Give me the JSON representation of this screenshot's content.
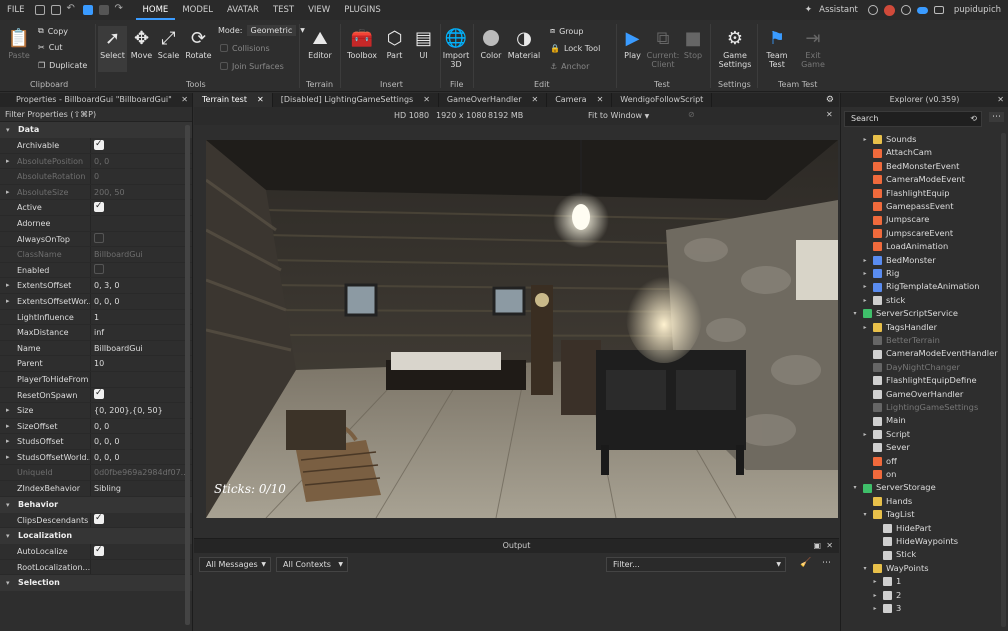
{
  "menu": {
    "items": [
      "FILE",
      "HOME",
      "MODEL",
      "AVATAR",
      "TEST",
      "VIEW",
      "PLUGINS"
    ],
    "assistant": "Assistant",
    "username": "pupidupich"
  },
  "ribbon": {
    "clipboard": {
      "paste": "Paste",
      "copy": "Copy",
      "cut": "Cut",
      "duplicate": "Duplicate",
      "label": "Clipboard"
    },
    "tools": {
      "select": "Select",
      "move": "Move",
      "scale": "Scale",
      "rotate": "Rotate",
      "mode_label": "Mode:",
      "mode_value": "Geometric",
      "collisions": "Collisions",
      "join": "Join Surfaces",
      "label": "Tools"
    },
    "terrain": {
      "editor": "Editor",
      "label": "Terrain"
    },
    "insert": {
      "toolbox": "Toolbox",
      "part": "Part",
      "ui": "UI",
      "label": "Insert"
    },
    "file": {
      "import": "Import\n3D",
      "label": "File"
    },
    "edit": {
      "color": "Color",
      "material": "Material",
      "group": "Group",
      "lock": "Lock Tool",
      "anchor": "Anchor",
      "label": "Edit"
    },
    "test": {
      "play": "Play",
      "current": "Current:\nClient",
      "stop": "Stop",
      "label": "Test"
    },
    "settings": {
      "game": "Game\nSettings",
      "label": "Settings"
    },
    "teamtest": {
      "team": "Team\nTest",
      "exit": "Exit\nGame",
      "label": "Team Test"
    }
  },
  "properties": {
    "title": "Properties - BillboardGui \"BillboardGui\"",
    "filter": "Filter Properties (⇧⌘P)",
    "sections": {
      "data": "Data",
      "behavior": "Behavior",
      "localization": "Localization",
      "selection": "Selection"
    },
    "rows": [
      {
        "name": "Archivable",
        "value": "",
        "check": "on"
      },
      {
        "name": "AbsolutePosition",
        "value": "0, 0",
        "dim": true,
        "exp": true
      },
      {
        "name": "AbsoluteRotation",
        "value": "0",
        "dim": true
      },
      {
        "name": "AbsoluteSize",
        "value": "200, 50",
        "dim": true,
        "exp": true
      },
      {
        "name": "Active",
        "value": "",
        "check": "on"
      },
      {
        "name": "Adornee",
        "value": ""
      },
      {
        "name": "AlwaysOnTop",
        "value": "",
        "check": "off"
      },
      {
        "name": "ClassName",
        "value": "BillboardGui",
        "dim": true
      },
      {
        "name": "Enabled",
        "value": "",
        "check": "off"
      },
      {
        "name": "ExtentsOffset",
        "value": "0, 3, 0",
        "exp": true
      },
      {
        "name": "ExtentsOffsetWor...",
        "value": "0, 0, 0",
        "exp": true
      },
      {
        "name": "LightInfluence",
        "value": "1"
      },
      {
        "name": "MaxDistance",
        "value": "inf"
      },
      {
        "name": "Name",
        "value": "BillboardGui"
      },
      {
        "name": "Parent",
        "value": "10"
      },
      {
        "name": "PlayerToHideFrom",
        "value": ""
      },
      {
        "name": "ResetOnSpawn",
        "value": "",
        "check": "on"
      },
      {
        "name": "Size",
        "value": "{0, 200},{0, 50}",
        "exp": true
      },
      {
        "name": "SizeOffset",
        "value": "0, 0",
        "exp": true
      },
      {
        "name": "StudsOffset",
        "value": "0, 0, 0",
        "exp": true
      },
      {
        "name": "StudsOffsetWorld...",
        "value": "0, 0, 0",
        "exp": true
      },
      {
        "name": "UniqueId",
        "value": "0d0fbe969a2984df07...",
        "dim": true
      },
      {
        "name": "ZIndexBehavior",
        "value": "Sibling"
      }
    ],
    "behavior_rows": [
      {
        "name": "ClipsDescendants",
        "value": "",
        "check": "on"
      }
    ],
    "localization_rows": [
      {
        "name": "AutoLocalize",
        "value": "",
        "check": "on"
      },
      {
        "name": "RootLocalization...",
        "value": ""
      }
    ]
  },
  "tabs": [
    "Terrain test",
    "[Disabled] LightingGameSettings",
    "GameOverHandler",
    "Camera",
    "WendigoFollowScript"
  ],
  "viewport": {
    "hd": "HD 1080",
    "res": "1920 x 1080",
    "mem": "8192 MB",
    "fit": "Fit to Window",
    "sticks": "Sticks: 0/10"
  },
  "output": {
    "title": "Output",
    "messages": "All Messages",
    "contexts": "All Contexts",
    "filter": "Filter..."
  },
  "explorer": {
    "title": "Explorer (v0.359)",
    "search": "Search",
    "items": [
      {
        "t": "Sounds",
        "d": 1,
        "ar": "▸",
        "c": "#e8c04a"
      },
      {
        "t": "AttachCam",
        "d": 1,
        "ar": "",
        "c": "#f06a3c"
      },
      {
        "t": "BedMonsterEvent",
        "d": 1,
        "ar": "",
        "c": "#f06a3c"
      },
      {
        "t": "CameraModeEvent",
        "d": 1,
        "ar": "",
        "c": "#f06a3c"
      },
      {
        "t": "FlashlightEquip",
        "d": 1,
        "ar": "",
        "c": "#f06a3c"
      },
      {
        "t": "GamepassEvent",
        "d": 1,
        "ar": "",
        "c": "#f06a3c"
      },
      {
        "t": "Jumpscare",
        "d": 1,
        "ar": "",
        "c": "#f06a3c"
      },
      {
        "t": "JumpscareEvent",
        "d": 1,
        "ar": "",
        "c": "#f06a3c"
      },
      {
        "t": "LoadAnimation",
        "d": 1,
        "ar": "",
        "c": "#f06a3c"
      },
      {
        "t": "BedMonster",
        "d": 1,
        "ar": "▸",
        "c": "#5a8cf0"
      },
      {
        "t": "Rig",
        "d": 1,
        "ar": "▸",
        "c": "#5a8cf0"
      },
      {
        "t": "RigTemplateAnimation",
        "d": 1,
        "ar": "▸",
        "c": "#5a8cf0"
      },
      {
        "t": "stick",
        "d": 1,
        "ar": "▸",
        "c": "#cfcfcf"
      },
      {
        "t": "ServerScriptService",
        "d": 0,
        "ar": "▾",
        "c": "#3fbf6a"
      },
      {
        "t": "TagsHandler",
        "d": 1,
        "ar": "▸",
        "c": "#e8c04a"
      },
      {
        "t": "BetterTerrain",
        "d": 1,
        "ar": "",
        "c": "#666",
        "dim": true
      },
      {
        "t": "CameraModeEventHandler",
        "d": 1,
        "ar": "",
        "c": "#d0d0d0"
      },
      {
        "t": "DayNightChanger",
        "d": 1,
        "ar": "",
        "c": "#666",
        "dim": true
      },
      {
        "t": "FlashlightEquipDefine",
        "d": 1,
        "ar": "",
        "c": "#d0d0d0"
      },
      {
        "t": "GameOverHandler",
        "d": 1,
        "ar": "",
        "c": "#d0d0d0"
      },
      {
        "t": "LightingGameSettings",
        "d": 1,
        "ar": "",
        "c": "#666",
        "dim": true
      },
      {
        "t": "Main",
        "d": 1,
        "ar": "",
        "c": "#d0d0d0"
      },
      {
        "t": "Script",
        "d": 1,
        "ar": "▸",
        "c": "#d0d0d0"
      },
      {
        "t": "Sever",
        "d": 1,
        "ar": "",
        "c": "#d0d0d0"
      },
      {
        "t": "off",
        "d": 1,
        "ar": "",
        "c": "#f06a3c"
      },
      {
        "t": "on",
        "d": 1,
        "ar": "",
        "c": "#f06a3c"
      },
      {
        "t": "ServerStorage",
        "d": 0,
        "ar": "▾",
        "c": "#3fbf6a"
      },
      {
        "t": "Hands",
        "d": 1,
        "ar": "",
        "c": "#e8c04a"
      },
      {
        "t": "TagList",
        "d": 1,
        "ar": "▾",
        "c": "#e8c04a"
      },
      {
        "t": "HidePart",
        "d": 2,
        "ar": "",
        "c": "#cfcfcf"
      },
      {
        "t": "HideWaypoints",
        "d": 2,
        "ar": "",
        "c": "#cfcfcf"
      },
      {
        "t": "Stick",
        "d": 2,
        "ar": "",
        "c": "#cfcfcf"
      },
      {
        "t": "WayPoints",
        "d": 1,
        "ar": "▾",
        "c": "#e8c04a"
      },
      {
        "t": "1",
        "d": 2,
        "ar": "▸",
        "c": "#cfcfcf"
      },
      {
        "t": "2",
        "d": 2,
        "ar": "▸",
        "c": "#cfcfcf"
      },
      {
        "t": "3",
        "d": 2,
        "ar": "▸",
        "c": "#cfcfcf"
      }
    ]
  }
}
